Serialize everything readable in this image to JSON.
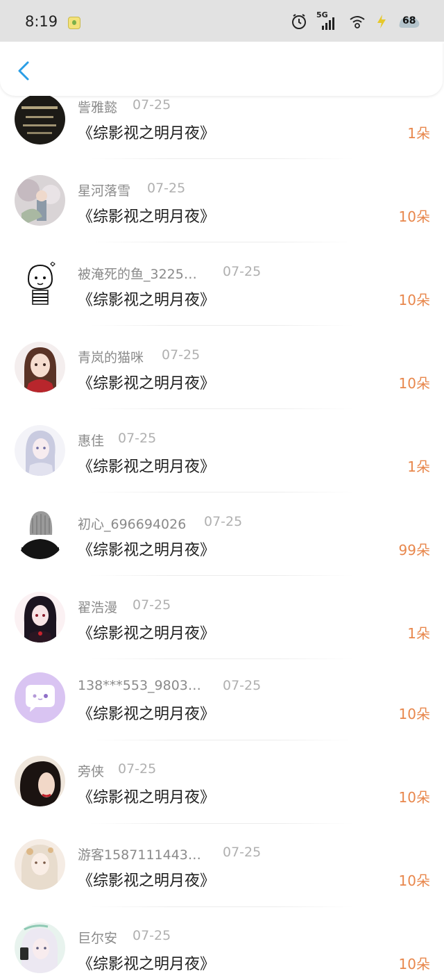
{
  "status_bar": {
    "time": "8:19",
    "network": "5G",
    "battery": "68"
  },
  "header": {
    "back_icon": "chevron-left-icon",
    "accent_color": "#2a9ee6"
  },
  "list": {
    "amount_color": "#e8874c",
    "items": [
      {
        "name": "訾雅懿",
        "date": "07-25",
        "title": "《综影视之明月夜》",
        "amount": "1朵"
      },
      {
        "name": "星河落雪",
        "date": "07-25",
        "title": "《综影视之明月夜》",
        "amount": "10朵"
      },
      {
        "name": "被淹死的鱼_3225…",
        "date": "07-25",
        "title": "《综影视之明月夜》",
        "amount": "10朵"
      },
      {
        "name": "青岚的猫咪",
        "date": "07-25",
        "title": "《综影视之明月夜》",
        "amount": "10朵"
      },
      {
        "name": "惠佳",
        "date": "07-25",
        "title": "《综影视之明月夜》",
        "amount": "1朵"
      },
      {
        "name": "初心_696694026",
        "date": "07-25",
        "title": "《综影视之明月夜》",
        "amount": "99朵"
      },
      {
        "name": "翟浩漫",
        "date": "07-25",
        "title": "《综影视之明月夜》",
        "amount": "1朵"
      },
      {
        "name": "138***553_9803…",
        "date": "07-25",
        "title": "《综影视之明月夜》",
        "amount": "10朵"
      },
      {
        "name": "旁侠",
        "date": "07-25",
        "title": "《综影视之明月夜》",
        "amount": "10朵"
      },
      {
        "name": "游客1587111443…",
        "date": "07-25",
        "title": "《综影视之明月夜》",
        "amount": "10朵"
      },
      {
        "name": "巨尔安",
        "date": "07-25",
        "title": "《综影视之明月夜》",
        "amount": "10朵"
      }
    ]
  }
}
